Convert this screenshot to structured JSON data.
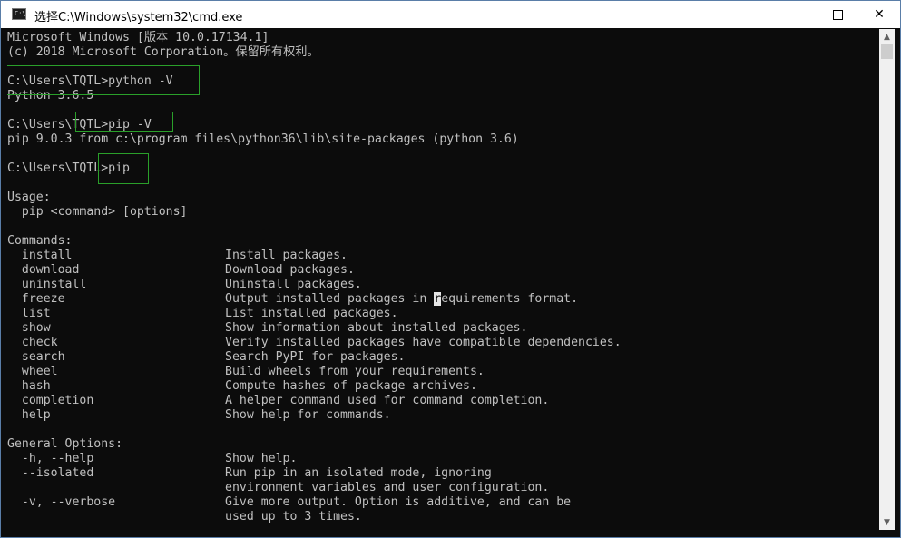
{
  "window": {
    "title": "选择C:\\Windows\\system32\\cmd.exe",
    "icon_text": "C:\\",
    "controls": {
      "minimize": "minimize-icon",
      "maximize": "maximize-icon",
      "close": "✕"
    }
  },
  "console": {
    "lines": [
      {
        "text": "Microsoft Windows [版本 10.0.17134.1]"
      },
      {
        "text": "(c) 2018 Microsoft Corporation。保留所有权利。"
      },
      {
        "text": ""
      },
      {
        "text": "C:\\Users\\TQTL>python -V"
      },
      {
        "text": "Python 3.6.5"
      },
      {
        "text": ""
      },
      {
        "text": "C:\\Users\\TQTL>pip -V"
      },
      {
        "text": "pip 9.0.3 from c:\\program files\\python36\\lib\\site-packages (python 3.6)"
      },
      {
        "text": ""
      },
      {
        "text": "C:\\Users\\TQTL>pip"
      },
      {
        "text": ""
      },
      {
        "text": "Usage:"
      },
      {
        "text": "  pip <command> [options]"
      },
      {
        "text": ""
      },
      {
        "text": "Commands:"
      },
      {
        "text": "  install",
        "desc": "Install packages."
      },
      {
        "text": "  download",
        "desc": "Download packages."
      },
      {
        "text": "  uninstall",
        "desc": "Uninstall packages."
      },
      {
        "text": "  freeze",
        "desc_before": "Output installed packages in ",
        "desc_cursor": "r",
        "desc_after": "equirements format."
      },
      {
        "text": "  list",
        "desc": "List installed packages."
      },
      {
        "text": "  show",
        "desc": "Show information about installed packages."
      },
      {
        "text": "  check",
        "desc": "Verify installed packages have compatible dependencies."
      },
      {
        "text": "  search",
        "desc": "Search PyPI for packages."
      },
      {
        "text": "  wheel",
        "desc": "Build wheels from your requirements."
      },
      {
        "text": "  hash",
        "desc": "Compute hashes of package archives."
      },
      {
        "text": "  completion",
        "desc": "A helper command used for command completion."
      },
      {
        "text": "  help",
        "desc": "Show help for commands."
      },
      {
        "text": ""
      },
      {
        "text": "General Options:"
      },
      {
        "text": "  -h, --help",
        "desc": "Show help."
      },
      {
        "text": "  --isolated",
        "desc": "Run pip in an isolated mode, ignoring"
      },
      {
        "text": "",
        "desc": "environment variables and user configuration."
      },
      {
        "text": "  -v, --verbose",
        "desc": "Give more output. Option is additive, and can be"
      },
      {
        "text": "",
        "desc": "used up to 3 times."
      }
    ]
  },
  "scrollbar": {
    "up": "▲",
    "down": "▼"
  }
}
